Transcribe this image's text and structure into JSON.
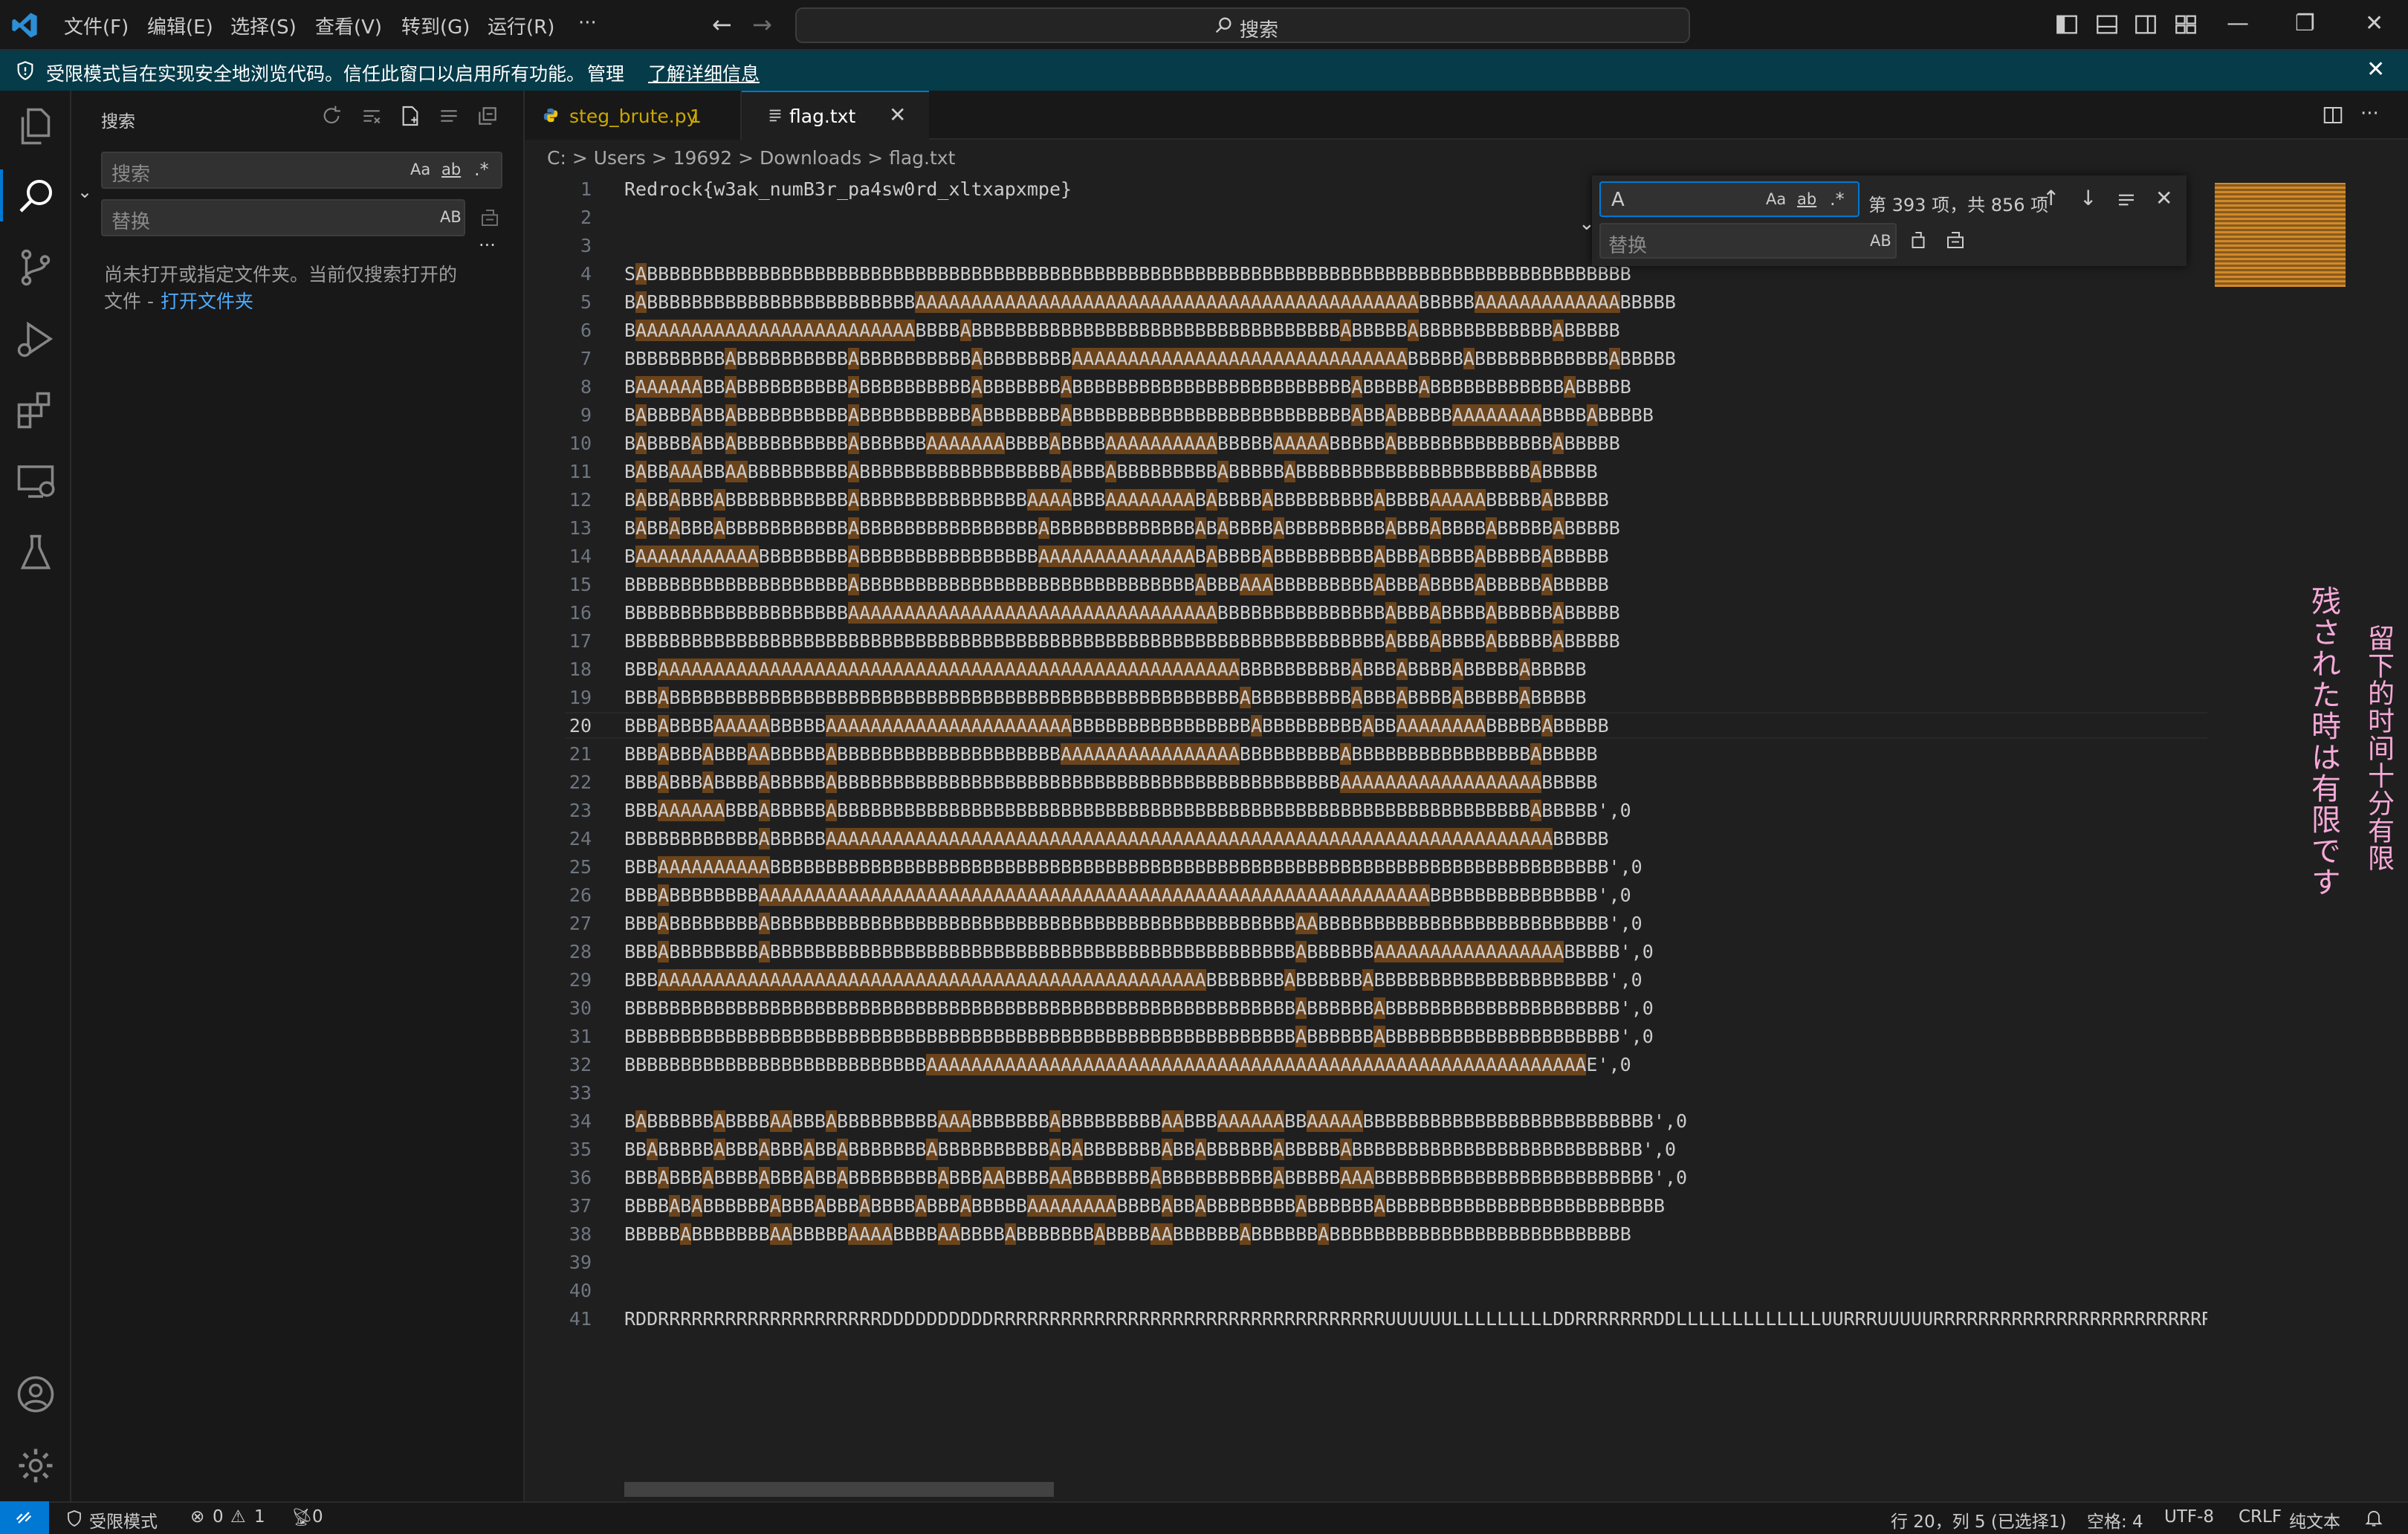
{
  "menu": [
    "文件(F)",
    "编辑(E)",
    "选择(S)",
    "查看(V)",
    "转到(G)",
    "运行(R)",
    "···"
  ],
  "command_center": {
    "label": "搜索"
  },
  "window_controls": {
    "minimize": "—",
    "maximize": "❐",
    "close": "✕"
  },
  "banner": {
    "text": "受限模式旨在实现安全地浏览代码。信任此窗口以启用所有功能。",
    "manage": "管理",
    "learn_more": "了解详细信息",
    "close": "✕"
  },
  "sidebar": {
    "title": "搜索",
    "search_placeholder": "搜索",
    "replace_placeholder": "替换",
    "opt_case": "Aa",
    "opt_word": "ab",
    "opt_regex": ".*",
    "opt_preserve": "AB",
    "more": "···",
    "message_line1": "尚未打开或指定文件夹。当前仅搜索打开的",
    "message_line2": "文件 -",
    "open_folder": "打开文件夹"
  },
  "tabs": [
    {
      "label": "steg_brute.py",
      "problems": "1"
    },
    {
      "label": "flag.txt",
      "close": "✕"
    }
  ],
  "breadcrumb": {
    "parts": [
      "C:",
      "Users",
      "19692",
      "Downloads",
      "flag.txt"
    ],
    "sep": " > "
  },
  "find_widget": {
    "query": "A",
    "count": "第 393 项，共 856 项",
    "replace_placeholder": "替换",
    "opt_case": "Aa",
    "opt_word": "ab",
    "opt_regex": ".*",
    "opt_preserve": "AB"
  },
  "editor": {
    "active_line": 20,
    "lines": [
      "Redrock{w3ak_numB3r_pa4sw0rd_xltxapxmpe}",
      "",
      "",
      "SABBBBBBBBBBBBBBBBBBBBBBBBBBBBBBBBBBBBBBBBBBBBBBBBBBBBBBBBBBBBBBBBBBBBBBBBBBBBBBBBBBBBBBBB",
      "BABBBBBBBBBBBBBBBBBBBBBBBBAAAAAAAAAAAAAAAAAAAAAAAAAAAAAAAAAAAAAAAAAAAAABBBBBAAAAAAAAAAAAABBBBB",
      "BAAAAAAAAAAAAAAAAAAAAAAAAABBBBABBBBBBBBBBBBBBBBBBBBBBBBBBBBBBBBBABBBBBABBBBBBBBBBBBABBBBB",
      "BBBBBBBBBABBBBBBBBBBABBBBBBBBBBABBBBBBBBAAAAAAAAAAAAAAAAAAAAAAAAAAAAAABBBBBABBBBBBBBBBBBABBBBB",
      "BAAAAAABBABBBBBBBBBBABBBBBBBBBBABBBBBBBABBBBBBBBBBBBBBBBBBBBBBBBBABBBBBABBBBBBBBBBBBABBBBB",
      "BABBBBABBABBBBBBBBBBABBBBBBBBBBABBBBBBBABBBBBBBBBBBBBBBBBBBBBBBBBABBABBBBBAAAAAAAABBBBABBBBB",
      "BABBBBABBABBBBBBBBBBABBBBBBAAAAAAABBBBABBBBAAAAAAAAAABBBBBAAAAABBBBBABBBBBBBBBBBBBBABBBBB",
      "BABBAAABBAABBBBBBBBBABBBBBBBBBBBBBBBBBBABBBABBBBBBBBBABBBBBABBBBBBBBBBBBBBBBBBBBBABBBBB",
      "BABBABBBABBBBBBBBBBBABBBBBBBBBBBBBBBAAAABBBAAAAAAAABABBBBABBBBBBBBBABBBBAAAAABBBBBABBBBB",
      "BABBABBBABBBBBBBBBBBABBBBBBBBBBBBBBBBABBBBBBBBBBBBBABABBBBABBBBBBBBBABBBABBBBABBBBBABBBBB",
      "BAAAAAAAAAAABBBBBBBBABBBBBBBBBBBBBBBBAAAAAAAAAAAAAABABBBBABBBBBBBBBABBBABBBBABBBBBABBBBB",
      "BBBBBBBBBBBBBBBBBBBBABBBBBBBBBBBBBBBBBBBBBBBBBBBBBBABBBAAABBBBBBBBBABBBABBBBABBBBBABBBBB",
      "BBBBBBBBBBBBBBBBBBBBAAAAAAAAAAAAAAAAAAAAAAAAAAAAAAAAABBBBBBBBBBBBBBBABBBABBBBABBBBBABBBBB",
      "BBBBBBBBBBBBBBBBBBBBBBBBBBBBBBBBBBBBBBBBBBBBBBBBBBBBBBBBBBBBBBBBBBBBABBBABBBBABBBBBABBBBB",
      "BBBAAAAAAAAAAAAAAAAAAAAAAAAAAAAAAAAAAAAAAAAAAAAAAAAAAAABBBBBBBBBBABBBABBBBABBBBBABBBBB",
      "BBBABBBBBBBBBBBBBBBBBBBBBBBBBBBBBBBBBBBBBBBBBBBBBBBBBBBABBBBBBBBBABBBABBBBABBBBBABBBBB",
      "BBBABBBBAAAAABBBBBAAAAAAAAAAAAAAAAAAAAAABBBBBBBBBBBBBBBBABBBBBBBBBABBAAAAAAAABBBBBABBBBB",
      "BBBABBBABBBAABBBBBABBBBBBBBBBBBBBBBBBBBAAAAAAAAAAAAAAAABBBBBBBBBABBBBBBBBBBBBBBBBABBBBB",
      "BBBABBBABBBBABBBBBABBBBBBBBBBBBBBBBBBBBBBBBBBBBBBBBBBBBBBBBBBBBBAAAAAAAAAAAAAAAAAABBBBB",
      "BBBAAAAAABBBABBBBBABBBBBBBBBBBBBBBBBBBBBBBBBBBBBBBBBBBBBBBBBBBBBBBBBBBBBBBBBBBBBBABBBBB',0",
      "BBBBBBBBBBBBABBBBBAAAAAAAAAAAAAAAAAAAAAAAAAAAAAAAAAAAAAAAAAAAAAAAAAAAAAAAAAAAAAAAAABBBBB",
      "BBBAAAAAAAAAABBBBBBBBBBBBBBBBBBBBBBBBBBBBBBBBBBBBBBBBBBBBBBBBBBBBBBBBBBBBBBBBBBBBBBBBBBB',0",
      "BBBABBBBBBBBAAAAAAAAAAAAAAAAAAAAAAAAAAAAAAAAAAAAAAAAAAAAAAAAAAAAAAAAAAAABBBBBBBBBBBBBBB',0",
      "BBBABBBBBBBBABBBBBBBBBBBBBBBBBBBBBBBBBBBBBBBBBBBBBBBBBBBBBBBAABBBBBBBBBBBBBBBBBBBBBBBBBB',0",
      "BBBABBBBBBBBABBBBBBBBBBBBBBBBBBBBBBBBBBBBBBBBBBBBBBBBBBBBBBBABBBBBBAAAAAAAAAAAAAAAAABBBBB',0",
      "BBBAAAAAAAAAAAAAAAAAAAAAAAAAAAAAAAAAAAAAAAAAAAAAAAAABBBBBBBABBBBBBABBBBBBBBBBBBBBBBBBBBB',0",
      "BBBBBBBBBBBBBBBBBBBBBBBBBBBBBBBBBBBBBBBBBBBBBBBBBBBBBBBBBBBBABBBBBBABBBBBBBBBBBBBBBBBBBBB',0",
      "BBBBBBBBBBBBBBBBBBBBBBBBBBBBBBBBBBBBBBBBBBBBBBBBBBBBBBBBBBBBABBBBBBABBBBBBBBBBBBBBBBBBBBB',0",
      "BBBBBBBBBBBBBBBBBBBBBBBBBBBAAAAAAAAAAAAAAAAAAAAAAAAAAAAAAAAAAAAAAAAAAAAAAAAAAAAAAAAAAAE',0",
      "",
      "BABBBBBBABBBBAABBBABBBBBBBBBAAABBBBBBBABBBBBBBBBAABBBAAAAAABBAAAAABBBBBBBBBBBBBBBBBBBBBBBBBB',0",
      "BBABBBBBABBBABBBABBABBBBBBBABBBBBBBBBBABABBBBBBBABBABBBBBBABBBBBABBBBBBBBBBBBBBBBBBBBBBBBBB',0",
      "BBBABBBABBBBABBBABBABBBBBBBBABBBAABBBBAABBBBBBBABBBBBBBBBBABBBBBAAABBBBBBBBBBBBBBBBBBBBBBBBB',0",
      "BBBBABABBBBBBABBBABBBABBBBABBBABBBBBAAAAAAAABBBBABBABBBBBBBBABBBBBBABBBBBBBBBBBBBBBBBBBBBBBBB",
      "BBBBBABBBBBBBAABBBBBAAAABBBBAABBBBABBBBBBBABBBBAABBBBBBABBBBBBABBBBBBBBBBBBBBBBBBBBBBBBBBB",
      "",
      "",
      "RDDRRRRRRRRRRRRRRRRRRRRDDDDDDDDDDRRRRRRRRRRRRRRRRRRRRRRRRRRRRRRRRRRRUUUUUULLLLLLLLLDDRRRRRRRDDLLLLLLLLLLLLLUURRRUUUUURRRRRRRRRRRRRRRRRRRRRRRRRRRRRRRDDD"
    ]
  },
  "minimap_overlay": {
    "line1": "残された時は有限です",
    "line2": "留下的时间十分有限"
  },
  "statusbar": {
    "restricted": "受限模式",
    "errors": "0",
    "warnings": "1",
    "ports": "0",
    "position": "行 20，列 5 (已选择1)",
    "spaces": "空格: 4",
    "encoding": "UTF-8",
    "eol": "CRLF",
    "language": "纯文本"
  },
  "colors": {
    "accent": "#0078d4",
    "banner": "#063b49",
    "match": "#9c5c1c",
    "warning_tab": "#cca700"
  }
}
